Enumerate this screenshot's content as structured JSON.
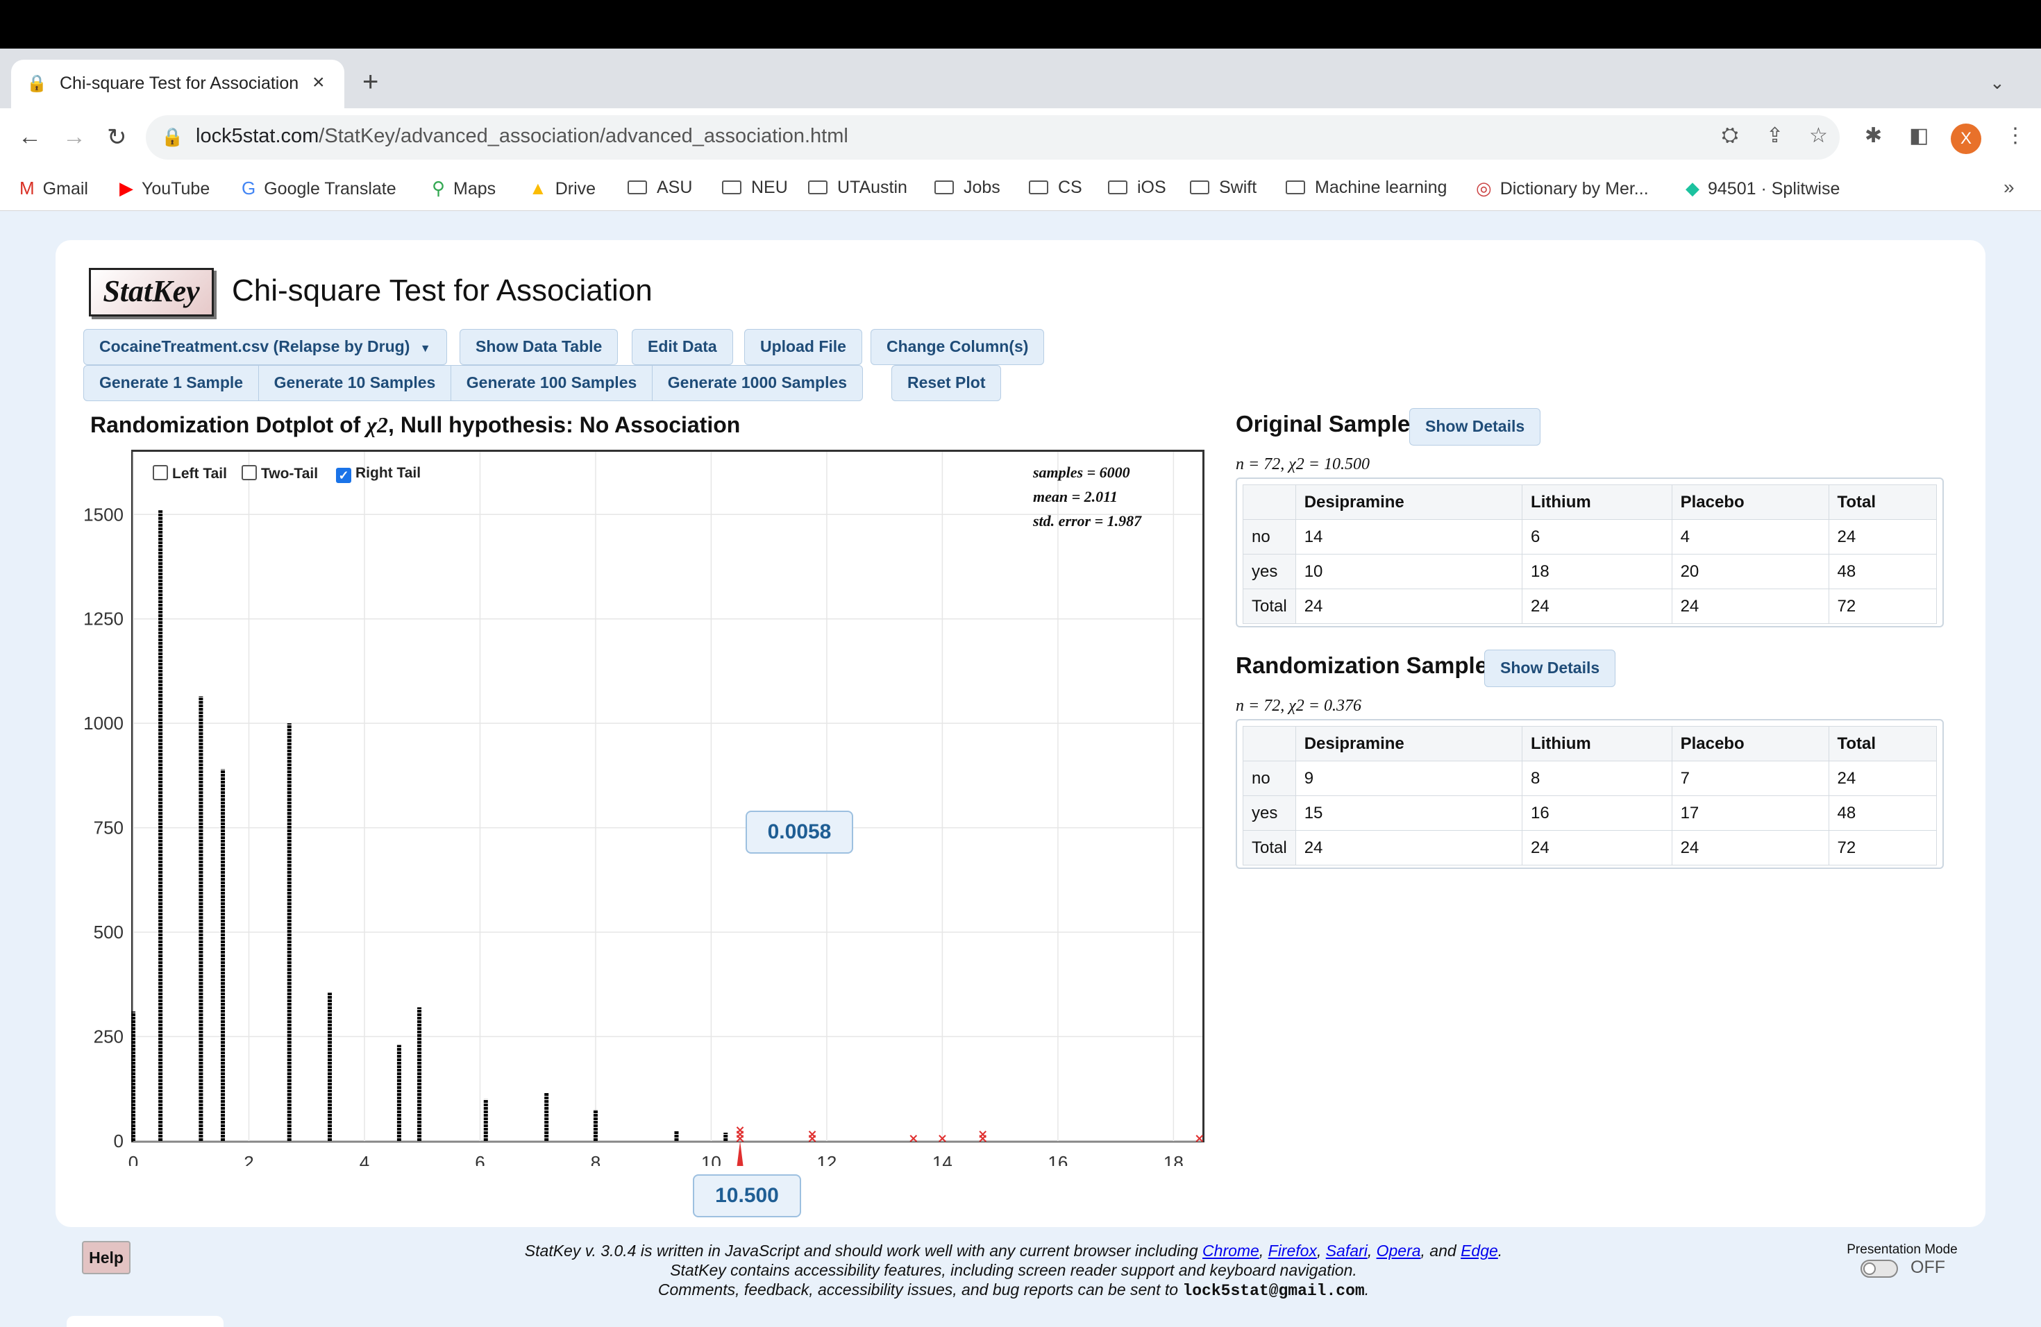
{
  "browser": {
    "tab_title": "Chi-square Test for Association",
    "tab_close": "×",
    "new_tab": "+",
    "url_host": "lock5stat.com",
    "url_path": "/StatKey/advanced_association/advanced_association.html",
    "avatar_letter": "X",
    "bookmarks": [
      "Gmail",
      "YouTube",
      "Google Translate",
      "Maps",
      "Drive",
      "ASU",
      "NEU",
      "UTAustin",
      "Jobs",
      "CS",
      "iOS",
      "Swift",
      "Machine learning",
      "Dictionary by Mer...",
      "94501 · Splitwise"
    ],
    "more": "»"
  },
  "app": {
    "logo": "StatKey",
    "title": "Chi-square Test for Association",
    "buttons": {
      "dataset": "CocaineTreatment.csv (Relapse by Drug)",
      "show_table": "Show Data Table",
      "edit": "Edit Data",
      "upload": "Upload File",
      "change_cols": "Change Column(s)",
      "gen1": "Generate 1 Sample",
      "gen10": "Generate 10 Samples",
      "gen100": "Generate 100 Samples",
      "gen1000": "Generate 1000 Samples",
      "reset": "Reset Plot"
    }
  },
  "plot": {
    "title_prefix": "Randomization Dotplot of ",
    "title_symbol": "χ2",
    "title_suffix": ",   Null hypothesis: No Association",
    "tails": {
      "left": "Left Tail",
      "two": "Two-Tail",
      "right": "Right Tail"
    },
    "stats": {
      "samples": "samples = 6000",
      "mean": "mean = 2.011",
      "se": "std. error = 1.987"
    },
    "pvalue": "0.0058",
    "observed": "10.500"
  },
  "chart_data": {
    "type": "bar",
    "xlim": [
      0,
      18.5
    ],
    "ylim": [
      0,
      1650
    ],
    "xticks": [
      0,
      2,
      4,
      6,
      8,
      10,
      12,
      14,
      16,
      18
    ],
    "yticks": [
      0,
      250,
      500,
      750,
      1000,
      1250,
      1500
    ],
    "grid": true,
    "x": [
      0.0,
      0.47,
      1.17,
      1.55,
      2.7,
      3.4,
      4.6,
      4.95,
      6.1,
      7.15,
      8.0,
      9.4,
      10.25
    ],
    "y": [
      310,
      1510,
      1065,
      890,
      1000,
      355,
      230,
      320,
      100,
      115,
      75,
      25,
      20
    ],
    "tail_points": [
      {
        "x": 10.5,
        "count": 3
      },
      {
        "x": 11.75,
        "count": 2
      },
      {
        "x": 13.5,
        "count": 1
      },
      {
        "x": 14.0,
        "count": 1
      },
      {
        "x": 14.7,
        "count": 2
      },
      {
        "x": 18.45,
        "count": 1
      }
    ],
    "observed_marker": 10.5,
    "tail_color": "#e03030",
    "bar_color": "#000000"
  },
  "original": {
    "heading": "Original Sample",
    "details": "Show Details",
    "meta_prefix": "n = 72, ",
    "meta_stat": "χ2 = 10.500",
    "columns": [
      "",
      "Desipramine",
      "Lithium",
      "Placebo",
      "Total"
    ],
    "rows": [
      [
        "no",
        "14",
        "6",
        "4",
        "24"
      ],
      [
        "yes",
        "10",
        "18",
        "20",
        "48"
      ],
      [
        "Total",
        "24",
        "24",
        "24",
        "72"
      ]
    ]
  },
  "random": {
    "heading": "Randomization Sample",
    "details": "Show Details",
    "meta_prefix": "n = 72, ",
    "meta_stat": "χ2 = 0.376",
    "columns": [
      "",
      "Desipramine",
      "Lithium",
      "Placebo",
      "Total"
    ],
    "rows": [
      [
        "no",
        "9",
        "8",
        "7",
        "24"
      ],
      [
        "yes",
        "15",
        "16",
        "17",
        "48"
      ],
      [
        "Total",
        "24",
        "24",
        "24",
        "72"
      ]
    ]
  },
  "footer": {
    "help": "Help",
    "line1_prefix": "StatKey v. 3.0.4 is written in JavaScript and should work well with any current browser including ",
    "browsers": [
      "Chrome",
      "Firefox",
      "Safari",
      "Opera",
      "Edge"
    ],
    "line2": "StatKey contains accessibility features, including screen reader support and keyboard navigation.",
    "line3_prefix": "Comments, feedback, accessibility issues, and bug reports can be sent to ",
    "email": "lock5stat@gmail.com",
    "presentation_label": "Presentation Mode",
    "presentation_state": "OFF"
  }
}
